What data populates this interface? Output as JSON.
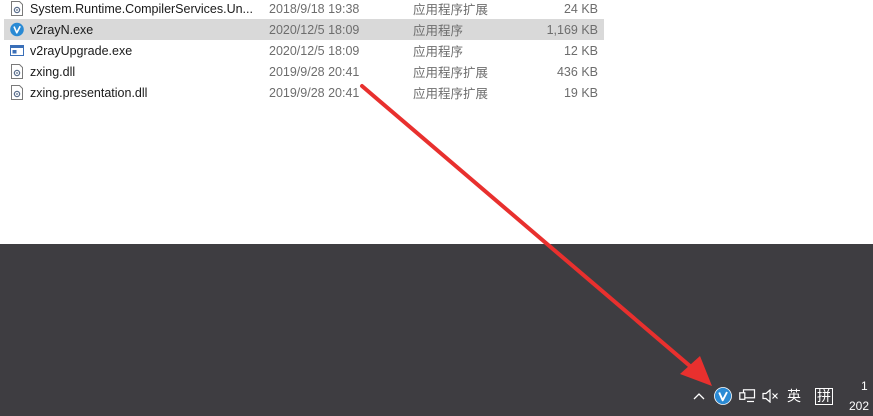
{
  "files": [
    {
      "name": "System.Runtime.CompilerServices.Un...",
      "date": "2018/9/18 19:38",
      "type": "应用程序扩展",
      "size": "24 KB",
      "icon": "dll-file-icon",
      "selected": false
    },
    {
      "name": "v2rayN.exe",
      "date": "2020/12/5 18:09",
      "type": "应用程序",
      "size": "1,169 KB",
      "icon": "v2rayn-app-icon",
      "selected": true
    },
    {
      "name": "v2rayUpgrade.exe",
      "date": "2020/12/5 18:09",
      "type": "应用程序",
      "size": "12 KB",
      "icon": "exe-window-icon",
      "selected": false
    },
    {
      "name": "zxing.dll",
      "date": "2019/9/28 20:41",
      "type": "应用程序扩展",
      "size": "436 KB",
      "icon": "dll-file-icon",
      "selected": false
    },
    {
      "name": "zxing.presentation.dll",
      "date": "2019/9/28 20:41",
      "type": "应用程序扩展",
      "size": "19 KB",
      "icon": "dll-file-icon",
      "selected": false
    }
  ],
  "tray": {
    "input_language": "英",
    "ime_mode": "拼",
    "clock_line1": "1",
    "clock_line2": "202"
  },
  "colors": {
    "selection": "#d9d9d9",
    "desktop": "#3e3d41",
    "annotation_arrow": "#e8302e",
    "v2ray_blue": "#2a8ad4"
  }
}
